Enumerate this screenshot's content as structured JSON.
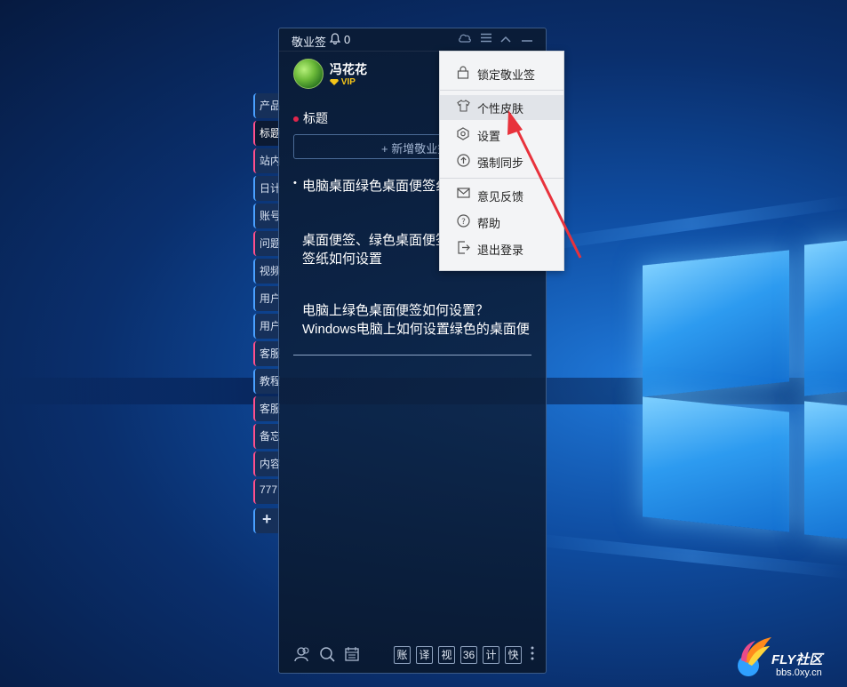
{
  "app": {
    "title": "敬业签",
    "notification_count": "0",
    "user": {
      "name": "冯花花",
      "badge": "VIP"
    },
    "section_title": "标题",
    "new_note_label": "+ 新增敬业签"
  },
  "side_tabs": [
    {
      "label": "产品"
    },
    {
      "label": "标题"
    },
    {
      "label": "站内"
    },
    {
      "label": "日计"
    },
    {
      "label": "账号"
    },
    {
      "label": "问题"
    },
    {
      "label": "视频"
    },
    {
      "label": "用户"
    },
    {
      "label": "用户"
    },
    {
      "label": "客服"
    },
    {
      "label": "教程"
    },
    {
      "label": "客服"
    },
    {
      "label": "备忘"
    },
    {
      "label": "内容"
    },
    {
      "label": "777"
    }
  ],
  "side_tab_add": "+",
  "notes": [
    {
      "text": "电脑桌面绿色桌面便签纟"
    },
    {
      "text": "桌面便签、绿色桌面便签、便签纸、便签纸如何设置"
    },
    {
      "text": "电脑上绿色桌面便签如何设置？Windows电脑上如何设置绿色的桌面便签纸？电脑上绿色的桌面便签纸差"
    }
  ],
  "bottom_buttons": [
    "账",
    "译",
    "视",
    "36",
    "计",
    "快"
  ],
  "menu": {
    "items": [
      {
        "label": "锁定敬业签",
        "icon": "lock-icon"
      },
      {
        "label": "个性皮肤",
        "icon": "tshirt-icon"
      },
      {
        "label": "设置",
        "icon": "hexagon-settings-icon"
      },
      {
        "label": "强制同步",
        "icon": "sync-up-icon"
      },
      {
        "label": "意见反馈",
        "icon": "mail-icon"
      },
      {
        "label": "帮助",
        "icon": "help-icon"
      },
      {
        "label": "退出登录",
        "icon": "logout-icon"
      }
    ]
  },
  "watermark": {
    "brand": "FLY社区",
    "url": "bbs.0xy.cn"
  },
  "colors": {
    "accent_pink": "#e0264c",
    "vip_gold": "#f5c518",
    "arrow_red": "#e8323c",
    "desktop_blue": "#0f4ea3"
  }
}
